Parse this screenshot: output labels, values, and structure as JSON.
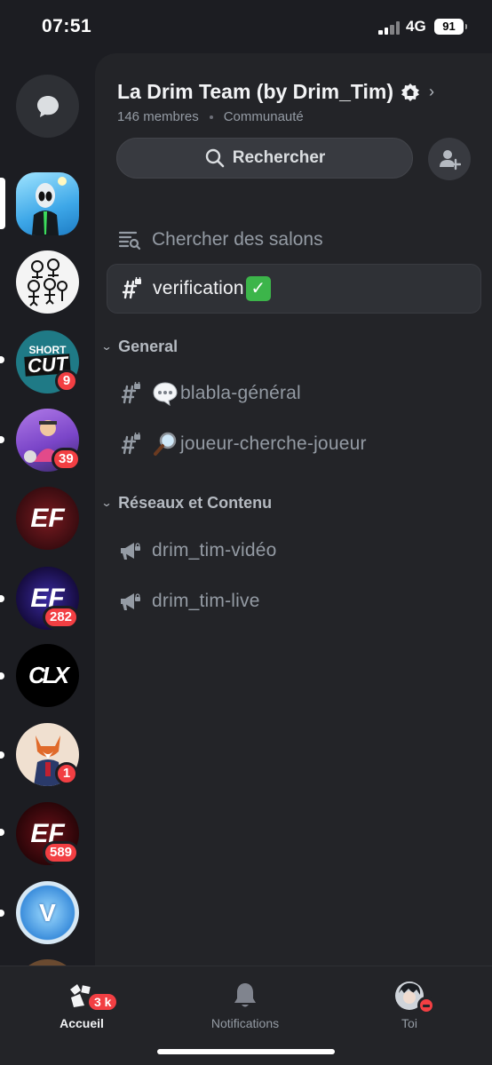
{
  "status_bar": {
    "time": "07:51",
    "network": "4G",
    "battery": "91"
  },
  "rail": {
    "items": [
      {
        "name": "direct-messages",
        "icon": "chat-bubble-icon"
      },
      {
        "name": "server-alien",
        "badge": ""
      },
      {
        "name": "server-sketch",
        "badge": ""
      },
      {
        "name": "server-shortcut",
        "text": "SHORT CUT",
        "badge": "9"
      },
      {
        "name": "server-purple",
        "badge": "39"
      },
      {
        "name": "server-ef",
        "text": "EF",
        "badge": ""
      },
      {
        "name": "server-ef-2",
        "text": "EF",
        "badge": "282"
      },
      {
        "name": "server-clx",
        "text": "CLX",
        "badge": ""
      },
      {
        "name": "server-fox",
        "badge": "1"
      },
      {
        "name": "server-ef-3",
        "text": "EF",
        "badge": "589"
      },
      {
        "name": "server-vbucks",
        "text": "V",
        "badge": ""
      }
    ]
  },
  "server": {
    "name": "La Drim Team (by Drim_Tim)",
    "members": "146 membres",
    "type": "Communauté",
    "search_label": "Rechercher",
    "browse_label": "Chercher des salons"
  },
  "channels": {
    "top": [
      {
        "name": "verification",
        "emoji": "✅",
        "selected": true
      }
    ],
    "categories": [
      {
        "name": "General",
        "channels": [
          {
            "emoji": "💬",
            "name": "blabla-général"
          },
          {
            "emoji": "🔎",
            "name": "joueur-cherche-joueur"
          }
        ]
      },
      {
        "name": "Réseaux et Contenu",
        "channels": [
          {
            "name": "drim_tim-vidéo"
          },
          {
            "name": "drim_tim-live"
          }
        ]
      }
    ]
  },
  "tabbar": {
    "home_label": "Accueil",
    "home_badge": "3 k",
    "notifications_label": "Notifications",
    "you_label": "Toi"
  },
  "colors": {
    "background": "#1c1d22",
    "panel": "#232428",
    "badge_red": "#f23f43",
    "muted_text": "#949ba4"
  }
}
